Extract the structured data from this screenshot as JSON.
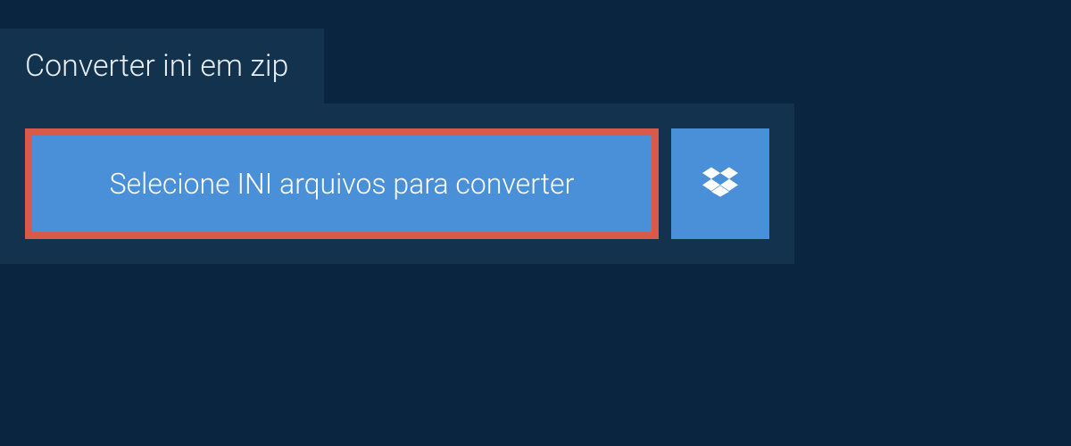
{
  "header": {
    "title": "Converter ini em zip"
  },
  "actions": {
    "select_files_label": "Selecione INI arquivos para converter",
    "dropbox_icon": "dropbox-icon"
  },
  "colors": {
    "background": "#0a2540",
    "panel": "#13324d",
    "button": "#4a90d9",
    "highlight_border": "#d85a4a",
    "text_light": "#e8eef4"
  }
}
